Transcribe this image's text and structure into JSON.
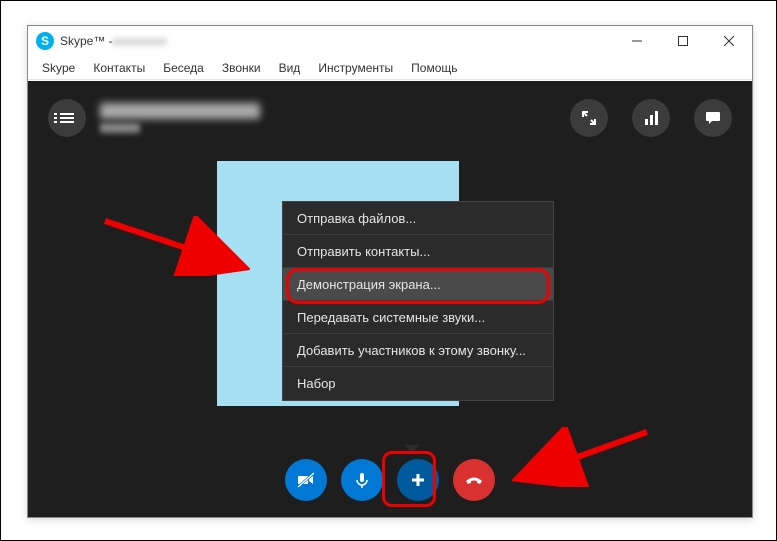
{
  "window": {
    "title_prefix": "Skype™ - "
  },
  "menubar": {
    "items": [
      "Skype",
      "Контакты",
      "Беседа",
      "Звонки",
      "Вид",
      "Инструменты",
      "Помощь"
    ]
  },
  "context_menu": {
    "items": [
      {
        "label": "Отправка файлов...",
        "highlight": false
      },
      {
        "label": "Отправить контакты...",
        "highlight": false
      },
      {
        "label": "Демонстрация экрана...",
        "highlight": true
      },
      {
        "label": "Передавать системные звуки...",
        "highlight": false
      },
      {
        "label": "Добавить участников к этому звонку...",
        "highlight": false
      },
      {
        "label": "Набор",
        "highlight": false
      }
    ]
  }
}
